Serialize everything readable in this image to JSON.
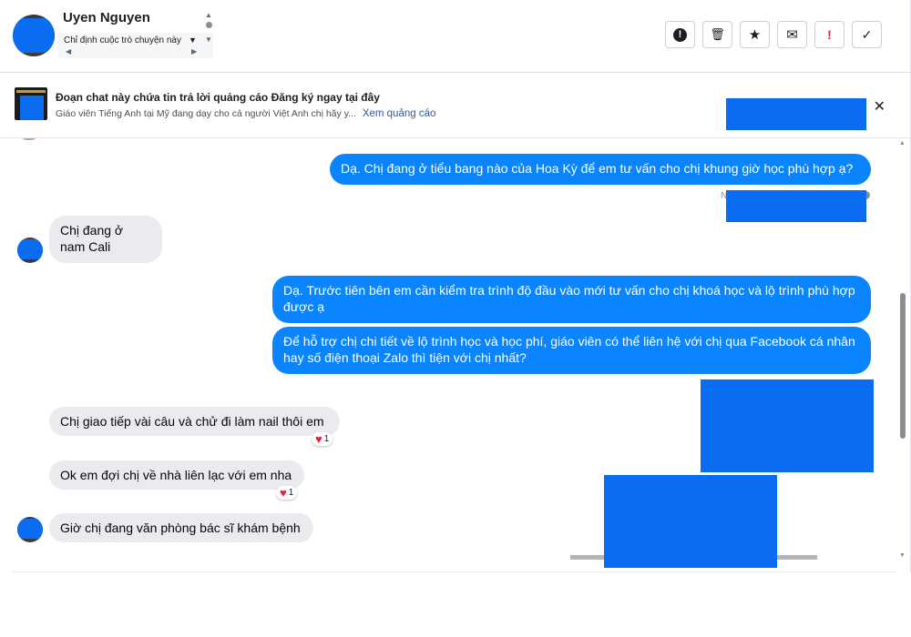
{
  "header": {
    "contact_name": "Uyen Nguyen",
    "assign_label": "Chỉ định cuộc trò chuyện này",
    "toolbar": [
      {
        "name": "report-spam-button",
        "icon": "exclamation-circle-icon",
        "glyph": "!"
      },
      {
        "name": "delete-button",
        "icon": "trash-icon",
        "glyph": "🗑"
      },
      {
        "name": "star-button",
        "icon": "star-icon",
        "glyph": "★"
      },
      {
        "name": "mark-unread-button",
        "icon": "envelope-icon",
        "glyph": "✉"
      },
      {
        "name": "follow-up-button",
        "icon": "flag-exclamation-icon",
        "glyph": "!"
      },
      {
        "name": "mark-done-button",
        "icon": "check-icon",
        "glyph": "✓"
      }
    ]
  },
  "ad": {
    "title": "Đoạn chat này chứa tin trả lời quảng cáo Đăng ký ngay tại đây",
    "subtitle": "Giáo viên Tiếng Anh tại Mỹ đang dạy cho cả người Việt Anh chị hãy y...",
    "link": "Xem quảng cáo",
    "close_glyph": "✕"
  },
  "messages": {
    "m1": "Dạ. Chị đang ở tiểu bang nào của Hoa Kỳ để em tư vấn cho chị khung giờ học phù hợp ạ?",
    "seen_fragment": "N",
    "m2": "Chị đang ở nam Cali",
    "m3": "Dạ. Trước tiên bên em cần kiểm tra trình độ đầu vào mới tư vấn cho chị khoá học và lộ trình phù hợp được ạ",
    "m4": "Để hỗ trợ chị chi tiết về lộ trình học và học phí, giáo viên có thể liên hệ với chị qua Facebook cá nhân hay số điện thoại Zalo thì tiện với chị nhất?",
    "m5": "Chị giao tiếp vài câu và chử đi làm nail thôi em",
    "m5_reaction_count": "1",
    "m6": "Ok em đợi chị về nhà liên lạc với em nha",
    "m6_reaction_count": "1",
    "m7": "Giờ chị đang văn phòng bác sĩ khám bệnh"
  },
  "colors": {
    "outgoing_bubble": "#0b84ff",
    "incoming_bubble": "#e9ebee",
    "redaction": "#0a6cf0",
    "reaction_heart": "#e41e3f",
    "link": "#385898"
  }
}
